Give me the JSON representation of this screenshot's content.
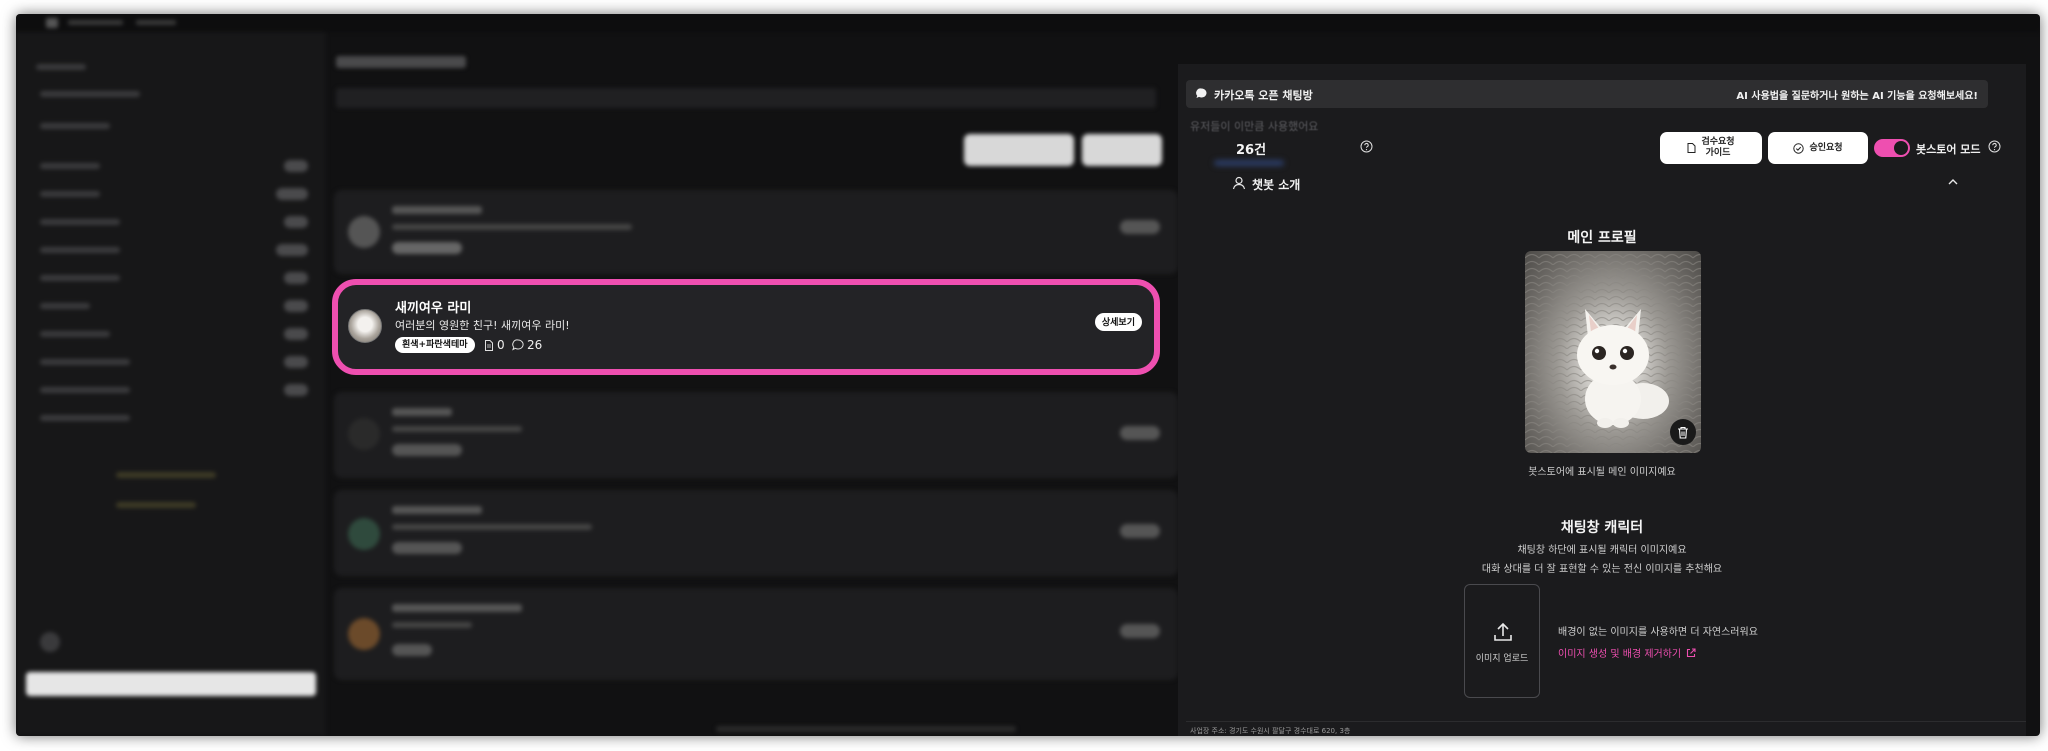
{
  "highlighted_card": {
    "name": "새끼여우 라미",
    "description": "여러분의 영원한 친구! 새끼여우 라미!",
    "tag": "흰색+파란색테마",
    "doc_count": "0",
    "comment_count": "26",
    "detail_button": "상세보기"
  },
  "right_panel": {
    "header_title": "카카오톡 오픈 채팅방",
    "header_hint": "AI 사용법을 질문하거나 원하는 AI 기능을 요청해보세요!",
    "usage_label": "유저들이 이만큼 사용했어요",
    "usage_count": "26건",
    "review_guide_line1": "검수요청",
    "review_guide_line2": "가이드",
    "approval_request": "승인요청",
    "botstore_mode": "봇스토어 모드",
    "botstore_mode_on": true,
    "chatbot_intro": "챗봇 소개",
    "main_profile_title": "메인 프로필",
    "main_profile_caption": "봇스토어에 표시될 메인 이미지예요",
    "chat_char_title": "채팅창 캐릭터",
    "chat_char_desc1": "채팅창 하단에 표시될 캐릭터 이미지예요",
    "chat_char_desc2": "대화 상대를 더 잘 표현할 수 있는 전신 이미지를 추천해요",
    "upload_label": "이미지 업로드",
    "bg_tip": "배경이 없는 이미지를 사용하면 더 자연스러워요",
    "generate_link": "이미지 생성 및 배경 제거하기",
    "footer_address": "사업장 주소: 경기도 수원시 팔달구 경수대로 620, 3층"
  },
  "colors": {
    "accent_pink": "#ee4fb0",
    "background": "#111112",
    "panel": "#1b1b1d"
  }
}
